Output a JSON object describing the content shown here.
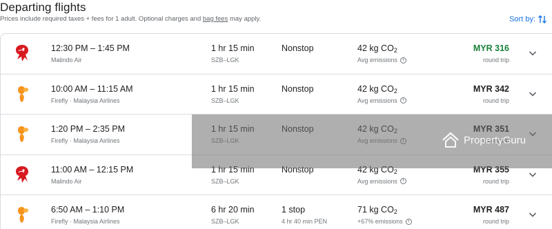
{
  "header": {
    "title": "Departing flights",
    "subtitle_pre": "Prices include required taxes + fees for 1 adult. Optional charges and ",
    "subtitle_link": "bag fees",
    "subtitle_post": " may apply.",
    "sort_label": "Sort by:"
  },
  "flights": [
    {
      "time": "12:30 PM – 1:45 PM",
      "airline": "Malindo Air",
      "duration": "1 hr 15 min",
      "route": "SZB–LGK",
      "stops": "Nonstop",
      "stop_detail": "",
      "emissions": "42 kg CO",
      "emissions_sub": "2",
      "emissions_note": "Avg emissions",
      "price": "MYR 316",
      "price_note": "round trip",
      "logo": "malindo-logo"
    },
    {
      "time": "10:00 AM – 11:15 AM",
      "airline": "Firefly · Malaysia Airlines",
      "duration": "1 hr 15 min",
      "route": "SZB–LGK",
      "stops": "Nonstop",
      "stop_detail": "",
      "emissions": "42 kg CO",
      "emissions_sub": "2",
      "emissions_note": "Avg emissions",
      "price": "MYR 342",
      "price_note": "round trip",
      "logo": "firefly-logo"
    },
    {
      "time": "1:20 PM – 2:35 PM",
      "airline": "Firefly · Malaysia Airlines",
      "duration": "1 hr 15 min",
      "route": "SZB–LGK",
      "stops": "Nonstop",
      "stop_detail": "",
      "emissions": "42 kg CO",
      "emissions_sub": "2",
      "emissions_note": "Avg emissions",
      "price": "MYR 351",
      "price_note": "round trip",
      "logo": "firefly-logo"
    },
    {
      "time": "11:00 AM – 12:15 PM",
      "airline": "Malindo Air",
      "duration": "1 hr 15 min",
      "route": "SZB–LGK",
      "stops": "Nonstop",
      "stop_detail": "",
      "emissions": "42 kg CO",
      "emissions_sub": "2",
      "emissions_note": "Avg emissions",
      "price": "MYR 355",
      "price_note": "round trip",
      "logo": "malindo-logo"
    },
    {
      "time": "6:50 AM – 1:10 PM",
      "airline": "Firefly · Malaysia Airlines",
      "duration": "6 hr 20 min",
      "route": "SZB–LGK",
      "stops": "1 stop",
      "stop_detail": "4 hr 40 min PEN",
      "emissions": "71 kg CO",
      "emissions_sub": "2",
      "emissions_note": "+67% emissions",
      "price": "MYR 487",
      "price_note": "round trip",
      "logo": "firefly-logo"
    }
  ],
  "watermark": "PropertyGuru",
  "colors": {
    "accent": "#1a73e8",
    "cheapest_price": "#188038",
    "malindo_red": "#d71920",
    "firefly_orange": "#f7941d"
  }
}
